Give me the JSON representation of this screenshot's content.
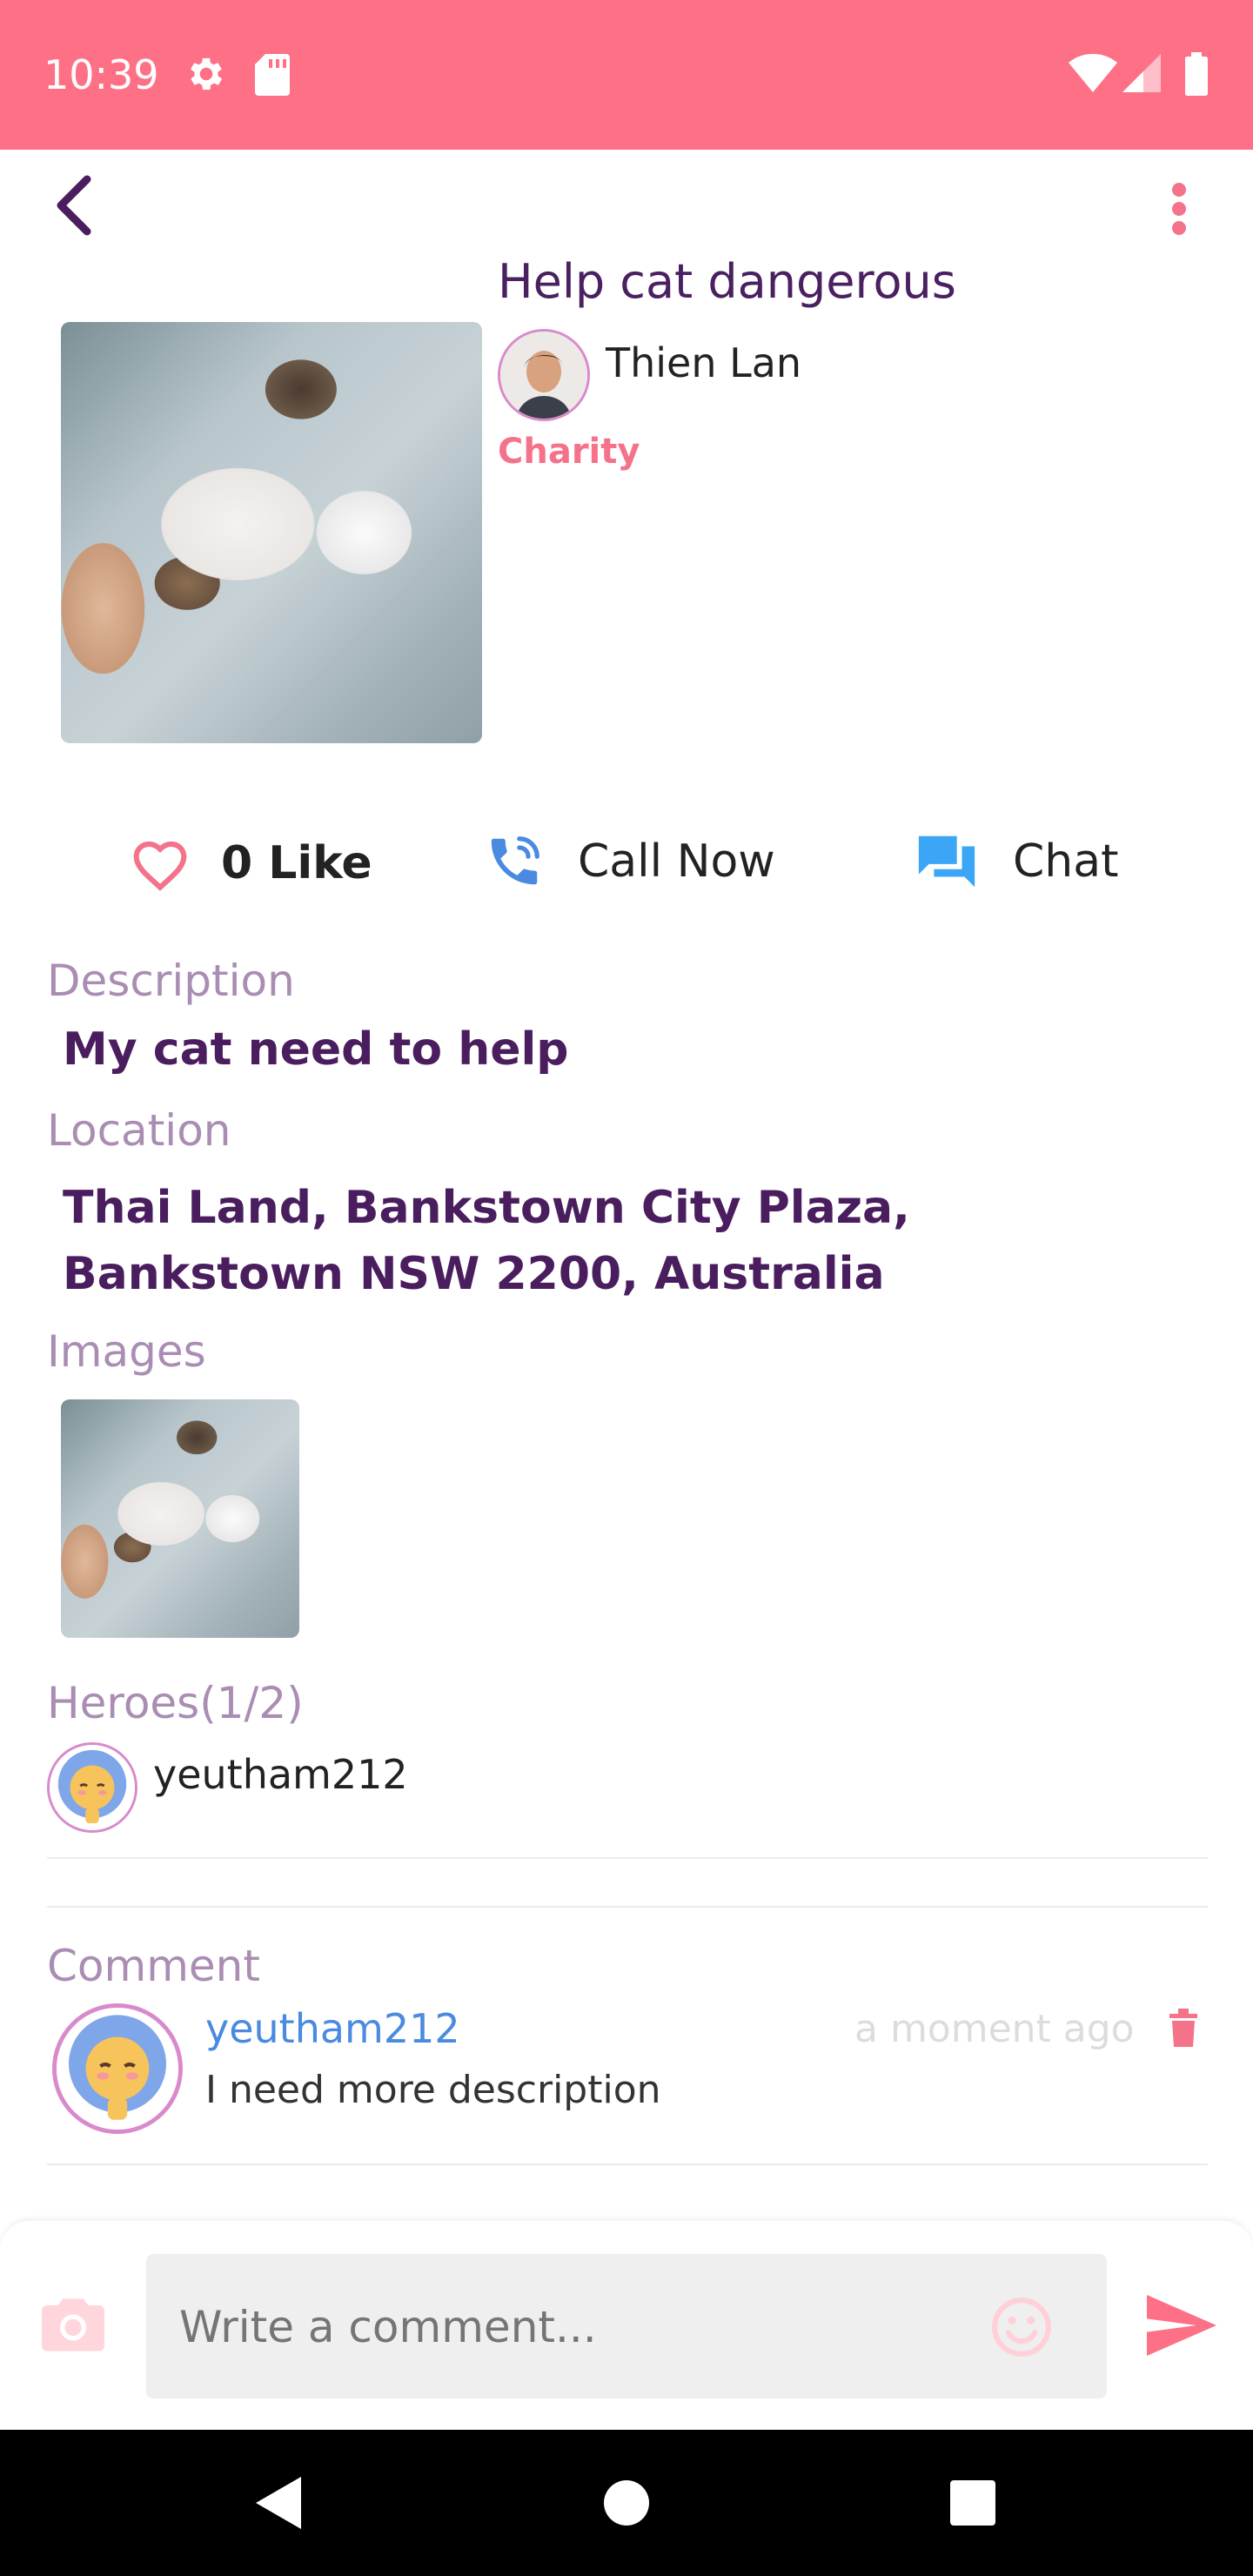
{
  "status_bar": {
    "time": "10:39",
    "background": "#fd7086"
  },
  "post": {
    "title": "Help cat dangerous",
    "author": "Thien Lan",
    "category": "Charity"
  },
  "actions": {
    "like_label": "0 Like",
    "call_label": "Call Now",
    "chat_label": "Chat"
  },
  "details": {
    "description_label": "Description",
    "description": "My cat need to help",
    "location_label": "Location",
    "location": "Thai Land, Bankstown City Plaza, Bankstown NSW 2200, Australia",
    "images_label": "Images"
  },
  "heroes": {
    "label": "Heroes(1/2)",
    "items": [
      {
        "name": "yeutham212"
      }
    ]
  },
  "comments": {
    "label": "Comment",
    "items": [
      {
        "user": "yeutham212",
        "time": "a moment ago",
        "text": "I need more description"
      }
    ]
  },
  "composer": {
    "placeholder": "Write a comment..."
  },
  "icons": {
    "back": "chevron-left-icon",
    "menu": "more-vert-icon",
    "like": "heart-outline-icon",
    "call": "phone-icon",
    "chat": "chat-icon",
    "delete": "trash-icon",
    "camera": "camera-icon",
    "emoji": "emoji-icon",
    "send": "send-icon"
  },
  "colors": {
    "accent": "#fd7086",
    "title": "#4a2060",
    "label": "#a98db3",
    "link": "#4a8ae0",
    "call_icon": "#4a8ae0",
    "chat_icon": "#3aa6f5"
  }
}
